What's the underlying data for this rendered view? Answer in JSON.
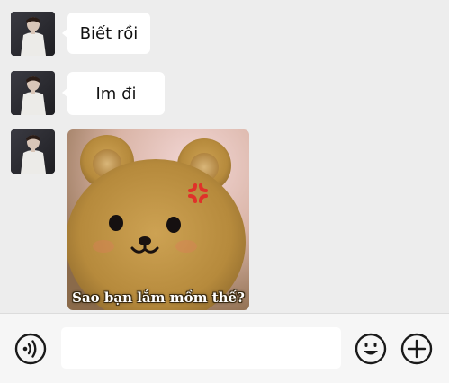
{
  "messages": [
    {
      "type": "text",
      "text": "Biết rồi"
    },
    {
      "type": "text",
      "text": "Im đi"
    },
    {
      "type": "sticker",
      "caption": "Sao bạn lắm mồm thế?",
      "depicts": "bear-plush-angry"
    }
  ],
  "composer": {
    "value": "",
    "voice_icon": "voice-icon",
    "emoji_icon": "emoji-icon",
    "add_icon": "add-icon"
  },
  "colors": {
    "chat_background": "#ededed",
    "bubble": "#ffffff",
    "input_bar": "#f6f6f6",
    "anger_mark": "#e0312a"
  }
}
